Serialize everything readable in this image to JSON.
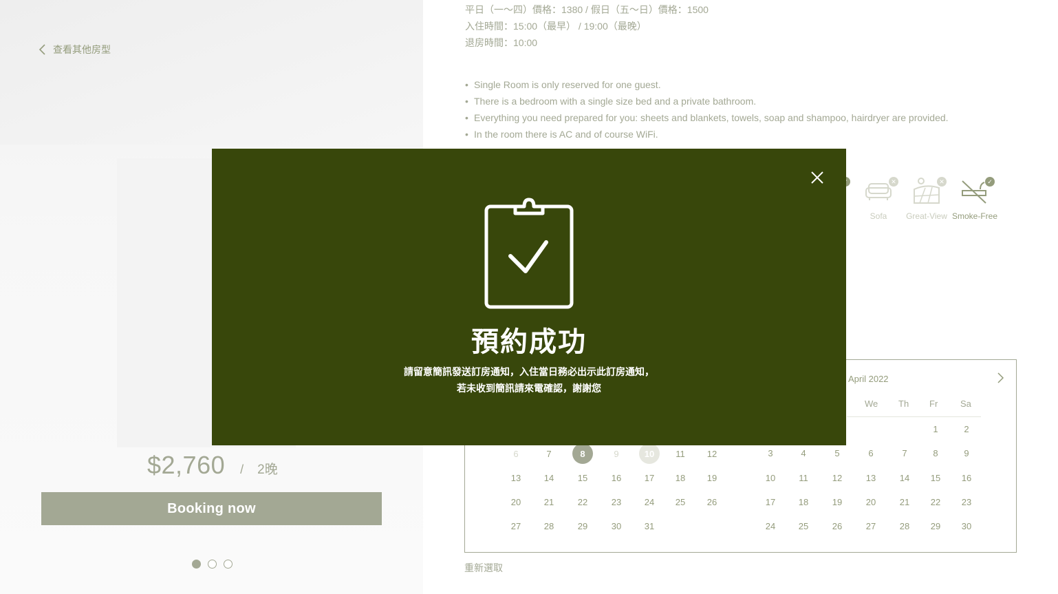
{
  "nav": {
    "back_label": "查看其他房型"
  },
  "booking": {
    "price": "$2,760",
    "separator": "/",
    "nights": "2晚",
    "button_label": "Booking now",
    "carousel_dots": 3,
    "active_dot": 0
  },
  "room_info": {
    "lines": [
      "平日（一～四）價格：1380 / 假日（五〜日）價格：1500",
      "入住時間：15:00（最早） / 19:00（最晚）",
      "退房時間：10:00"
    ],
    "bullets": [
      "Single Room is only reserved for one guest.",
      "There is a bedroom with a single size bed and a private bathroom.",
      "Everything you need prepared for you: sheets and blankets, towels, soap and shampoo, hairdryer are provided.",
      "In the room there is AC and of course WiFi."
    ]
  },
  "amenities": [
    {
      "label": "",
      "icon": "partial-amenity-icon",
      "available": true
    },
    {
      "label": "Sofa",
      "icon": "sofa-icon",
      "available": false
    },
    {
      "label": "Great-View",
      "icon": "great-view-icon",
      "available": false
    },
    {
      "label": "Smoke-Free",
      "icon": "no-smoking-icon",
      "available": true
    }
  ],
  "calendar": {
    "right_month_title": "April 2022",
    "weekday_headers_visible": [
      "We",
      "Th",
      "Fr",
      "Sa"
    ],
    "left_month": {
      "rows": [
        [
          "6",
          "7",
          "8",
          "9",
          "10",
          "11",
          "12"
        ],
        [
          "13",
          "14",
          "15",
          "16",
          "17",
          "18",
          "19"
        ],
        [
          "20",
          "21",
          "22",
          "23",
          "24",
          "25",
          "26"
        ],
        [
          "27",
          "28",
          "29",
          "30",
          "31",
          "",
          ""
        ]
      ],
      "faded": [
        "6",
        "9"
      ],
      "selected_start": "8",
      "selected_end": "10"
    },
    "right_month": {
      "rows": [
        [
          "",
          "",
          "",
          "",
          "",
          "1",
          "2"
        ],
        [
          "3",
          "4",
          "5",
          "6",
          "7",
          "8",
          "9"
        ],
        [
          "10",
          "11",
          "12",
          "13",
          "14",
          "15",
          "16"
        ],
        [
          "17",
          "18",
          "19",
          "20",
          "21",
          "22",
          "23"
        ],
        [
          "24",
          "25",
          "26",
          "27",
          "28",
          "29",
          "30"
        ]
      ]
    },
    "reset_label": "重新選取"
  },
  "modal": {
    "title": "預約成功",
    "message_line1": "請留意簡訊發送訂房通知，入住當日務必出示此訂房通知，",
    "message_line2": "若未收到簡訊請來電確認，謝謝您",
    "icon": "clipboard-check-icon",
    "close_icon": "close-icon"
  },
  "colors": {
    "modal_bg": "#38470b",
    "accent": "#949c7c",
    "button_bg": "#a3a894"
  }
}
